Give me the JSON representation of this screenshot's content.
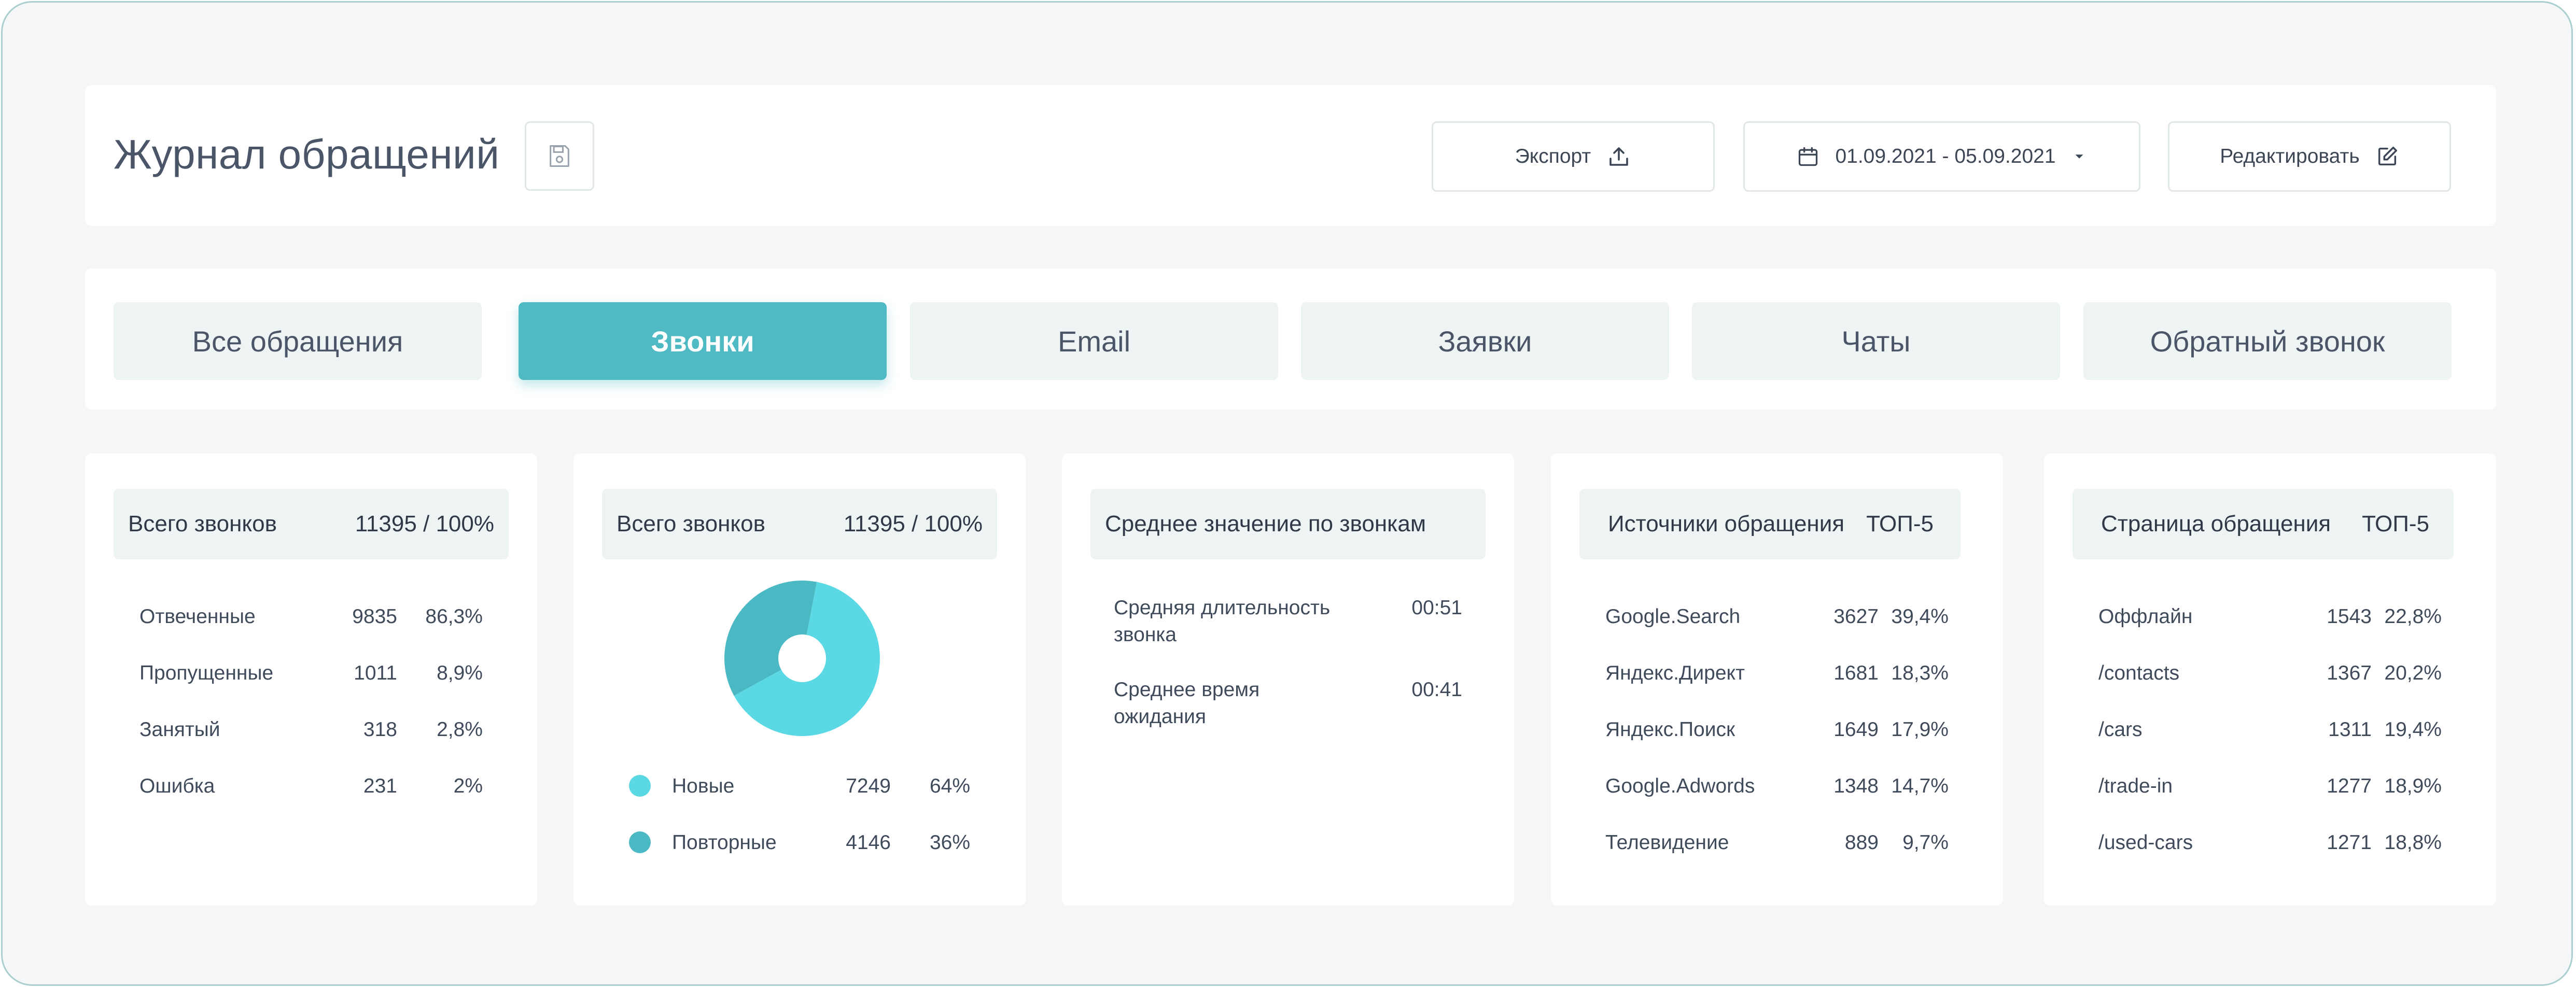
{
  "header": {
    "title": "Журнал обращений",
    "export_label": "Экспорт",
    "date_range": "01.09.2021 - 05.09.2021",
    "edit_label": "Редактировать"
  },
  "tabs": [
    {
      "label": "Все обращения",
      "active": false
    },
    {
      "label": "Звонки",
      "active": true
    },
    {
      "label": "Email",
      "active": false
    },
    {
      "label": "Заявки",
      "active": false
    },
    {
      "label": "Чаты",
      "active": false
    },
    {
      "label": "Обратный звонок",
      "active": false
    }
  ],
  "colors": {
    "accent": "#4fbac3",
    "new_calls": "#5ad8e4",
    "repeat_calls": "#4ab9c4"
  },
  "calls_card": {
    "title": "Всего звонков",
    "total": "11395 / 100%",
    "rows": [
      {
        "label": "Отвеченные",
        "count": "9835",
        "percent": "86,3%"
      },
      {
        "label": "Пропущенные",
        "count": "1011",
        "percent": "8,9%"
      },
      {
        "label": "Занятый",
        "count": "318",
        "percent": "2,8%"
      },
      {
        "label": "Ошибка",
        "count": "231",
        "percent": "2%"
      }
    ]
  },
  "donut_card": {
    "title": "Всего звонков",
    "total": "11395 / 100%",
    "legend": [
      {
        "label": "Новые",
        "count": "7249",
        "percent": "64%"
      },
      {
        "label": "Повторные",
        "count": "4146",
        "percent": "36%"
      }
    ]
  },
  "chart_data": {
    "type": "pie",
    "categories": [
      "Новые",
      "Повторные"
    ],
    "values": [
      64,
      36
    ]
  },
  "avg_card": {
    "title": "Среднее значение по звонкам",
    "rows": [
      {
        "label": "Средняя длительность звонка",
        "value": "00:51"
      },
      {
        "label": "Среднее время ожидания",
        "value": "00:41"
      }
    ]
  },
  "sources_card": {
    "title": "Источники обращения",
    "badge": "ТОП-5",
    "rows": [
      {
        "label": "Google.Search",
        "count": "3627",
        "percent": "39,4%"
      },
      {
        "label": "Яндекс.Директ",
        "count": "1681",
        "percent": "18,3%"
      },
      {
        "label": "Яндекс.Поиск",
        "count": "1649",
        "percent": "17,9%"
      },
      {
        "label": "Google.Adwords",
        "count": "1348",
        "percent": "14,7%"
      },
      {
        "label": "Телевидение",
        "count": "889",
        "percent": "9,7%"
      }
    ]
  },
  "pages_card": {
    "title": "Страница обращения",
    "badge": "ТОП-5",
    "rows": [
      {
        "label": "Оффлайн",
        "count": "1543",
        "percent": "22,8%"
      },
      {
        "label": "/contacts",
        "count": "1367",
        "percent": "20,2%"
      },
      {
        "label": "/cars",
        "count": "1311",
        "percent": "19,4%"
      },
      {
        "label": "/trade-in",
        "count": "1277",
        "percent": "18,9%"
      },
      {
        "label": "/used-cars",
        "count": "1271",
        "percent": "18,8%"
      }
    ]
  }
}
